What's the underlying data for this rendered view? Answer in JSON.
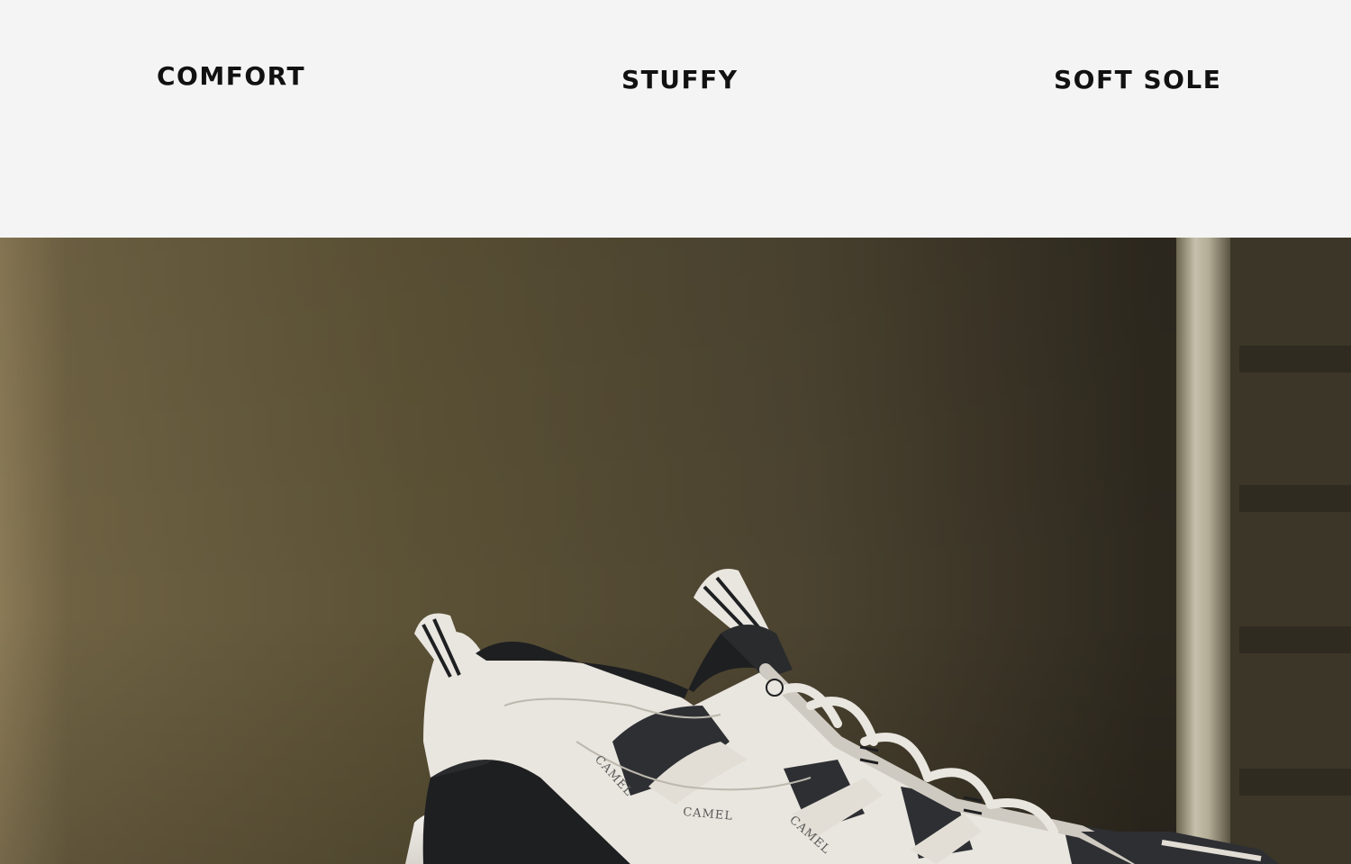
{
  "features": [
    {
      "label": "COMFORT"
    },
    {
      "label": "STUFFY"
    },
    {
      "label": "SOFT SOLE"
    }
  ],
  "shoe": {
    "brand": "CAMEL"
  },
  "colors": {
    "top_band": "#f4f4f4",
    "backdrop": "#5a4f34",
    "shoe_upper": "#e9e6df",
    "shoe_accent": "#1e1f21"
  }
}
